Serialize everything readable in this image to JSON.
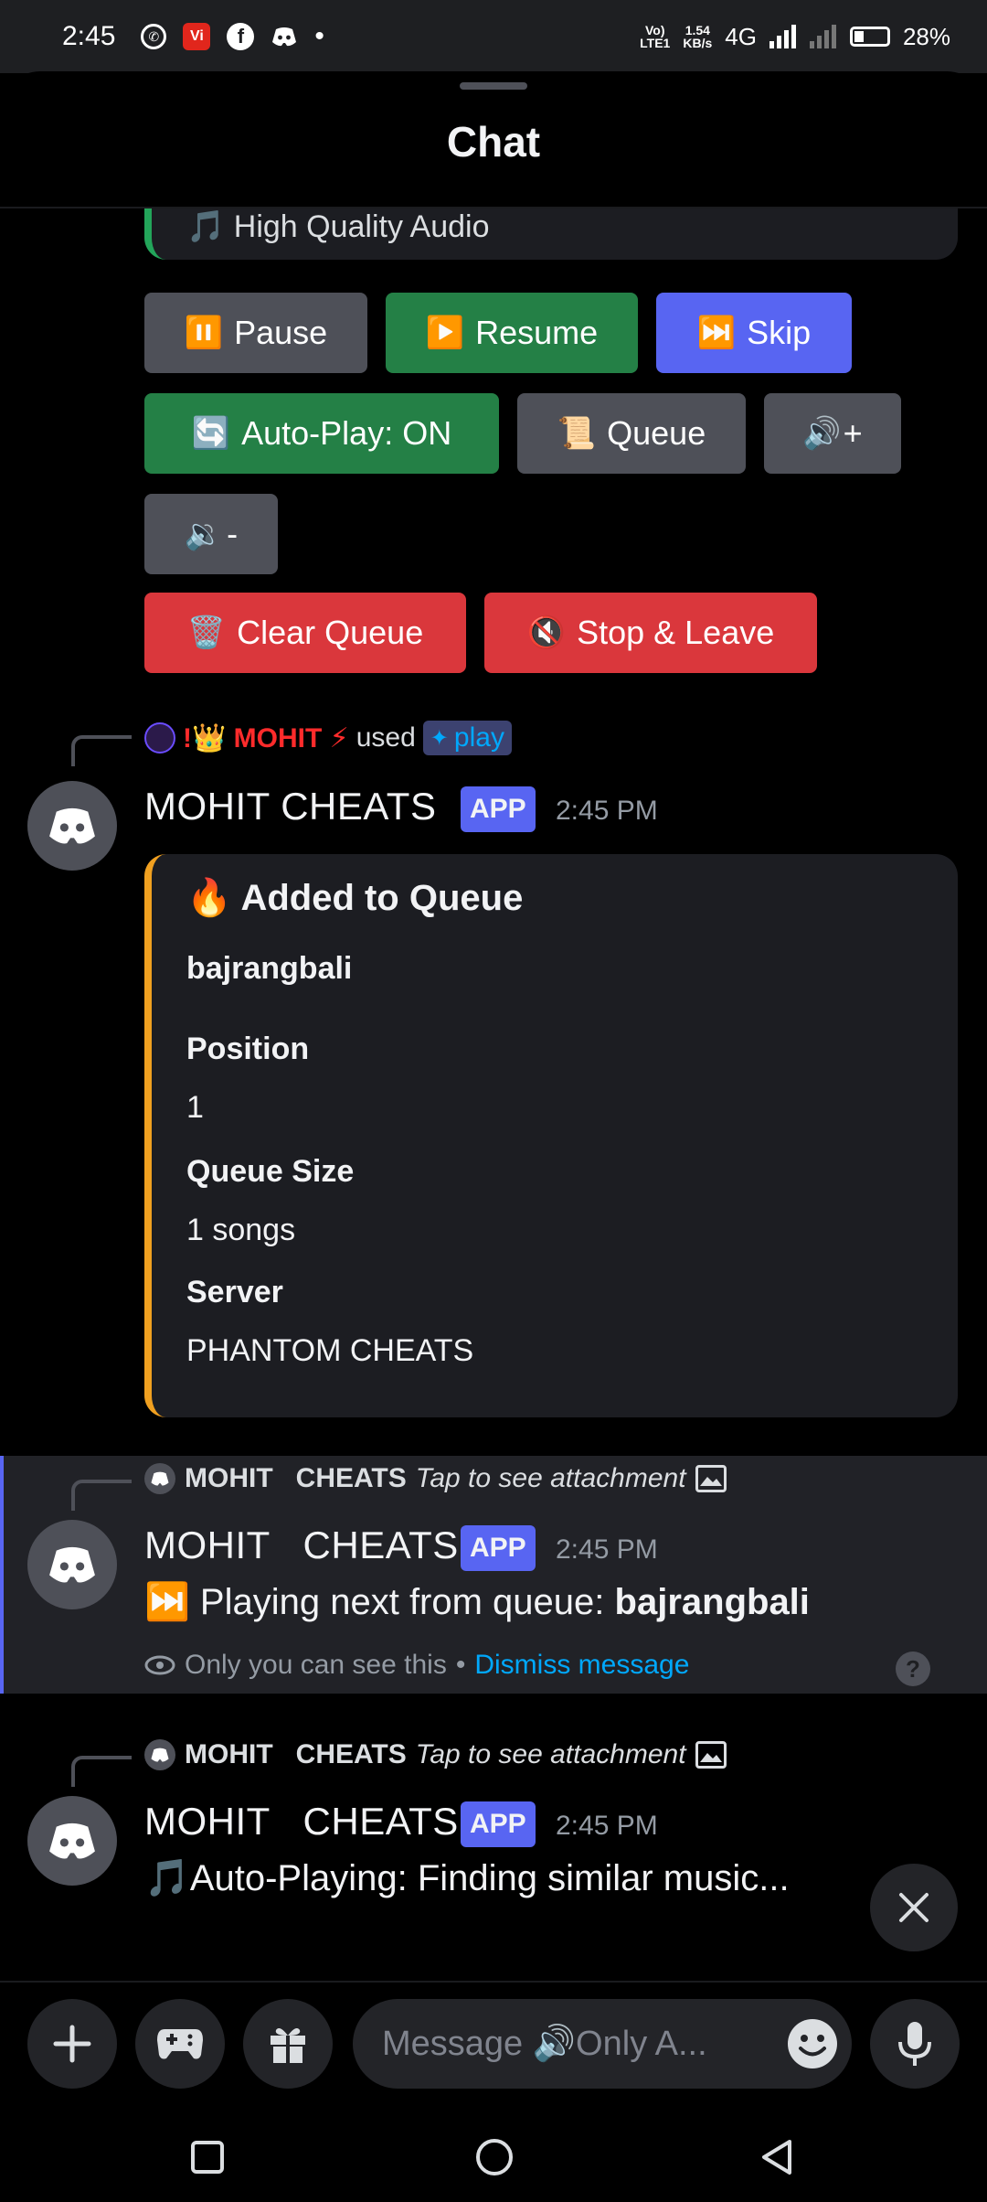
{
  "status_bar": {
    "time": "2:45",
    "network": "4G",
    "rate_value": "1.54",
    "rate_unit": "KB/s",
    "volte": "LTE1",
    "battery": "28%"
  },
  "header": {
    "title": "Chat"
  },
  "partial_embed": {
    "text": "🎵 High Quality Audio"
  },
  "controls": {
    "pause": "Pause",
    "resume": "Resume",
    "skip": "Skip",
    "autoplay": "Auto-Play: ON",
    "queue": "Queue",
    "vol_up": "+",
    "vol_down": "-",
    "clear_queue": "Clear Queue",
    "stop_leave": "Stop & Leave"
  },
  "message1": {
    "reply_user": "!👑 MOHIT ⚡",
    "reply_used": "used",
    "reply_command": "play",
    "author": "MOHIT   CHEATS",
    "badge": "APP",
    "time": "2:45 PM",
    "embed": {
      "title": "Added to Queue",
      "song": "bajrangbali",
      "fields": [
        {
          "name": "Position",
          "value": "1"
        },
        {
          "name": "Queue Size",
          "value": "1 songs"
        },
        {
          "name": "Server",
          "value": "PHANTOM CHEATS"
        }
      ]
    }
  },
  "message2": {
    "reply_author": "MOHIT   CHEATS",
    "reply_text": "Tap to see attachment",
    "author": "MOHIT   CHEATS",
    "badge": "APP",
    "time": "2:45 PM",
    "text_prefix": "Playing next from queue:",
    "text_bold": "bajrangbali",
    "ephemeral_note": "Only you can see this",
    "dismiss": "Dismiss message"
  },
  "message3": {
    "reply_author": "MOHIT   CHEATS",
    "reply_text": "Tap to see attachment",
    "author": "MOHIT   CHEATS",
    "badge": "APP",
    "time": "2:45 PM",
    "text": "Auto-Playing: Finding similar music..."
  },
  "composer": {
    "placeholder": "Message 🔊Only A..."
  }
}
